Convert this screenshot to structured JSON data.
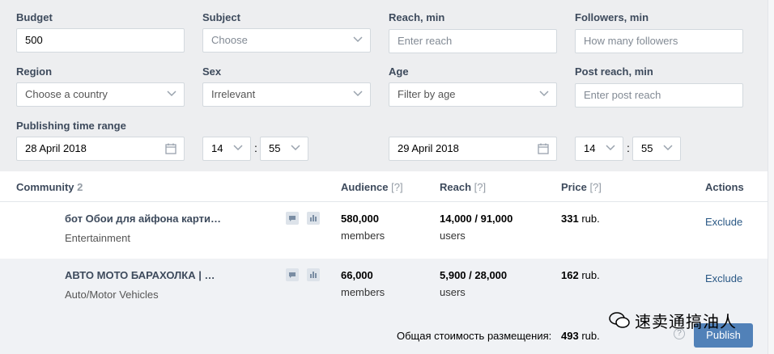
{
  "filters": {
    "budget": {
      "label": "Budget",
      "value": "500"
    },
    "subject": {
      "label": "Subject",
      "value": "Choose"
    },
    "reach_min": {
      "label": "Reach, min",
      "placeholder": "Enter reach"
    },
    "followers_min": {
      "label": "Followers, min",
      "placeholder": "How many followers"
    },
    "region": {
      "label": "Region",
      "value": "Choose a country"
    },
    "sex": {
      "label": "Sex",
      "value": "Irrelevant"
    },
    "age": {
      "label": "Age",
      "value": "Filter by age"
    },
    "post_reach_min": {
      "label": "Post reach, min",
      "placeholder": "Enter post reach"
    },
    "time_range": {
      "label": "Publishing time range",
      "start_date": "28 April 2018",
      "start_hour": "14",
      "start_minute": "55",
      "end_date": "29 April 2018",
      "end_hour": "14",
      "end_minute": "55",
      "separator": ":"
    }
  },
  "table": {
    "headers": {
      "community": "Community",
      "community_count": "2",
      "audience": "Audience",
      "reach": "Reach",
      "price": "Price",
      "actions": "Actions",
      "help": "[?]"
    },
    "rows": [
      {
        "name": "бот Обои для айфона карти…",
        "category": "Entertainment",
        "audience": "580,000",
        "audience_unit": "members",
        "reach": "14,000 / 91,000",
        "reach_unit": "users",
        "price": "331",
        "price_unit": "rub.",
        "action": "Exclude"
      },
      {
        "name": "АВТО МОТО БАРАХОЛКА | …",
        "category": "Auto/Motor Vehicles",
        "audience": "66,000",
        "audience_unit": "members",
        "reach": "5,900 / 28,000",
        "reach_unit": "users",
        "price": "162",
        "price_unit": "rub.",
        "action": "Exclude"
      }
    ]
  },
  "footer": {
    "total_label": "Общая стоимость размещения:",
    "total_value": "493",
    "total_unit": "rub.",
    "help": "?",
    "publish": "Publish"
  },
  "watermark": "速卖通搞油人",
  "icons": {
    "comment": "comment-icon",
    "stats": "bar-chart-icon",
    "calendar": "calendar-icon",
    "dropdown": "chevron-down-icon"
  },
  "colors": {
    "accent": "#5181b8",
    "link": "#2a5885",
    "label": "#3d4a5c",
    "panel_bg": "#edeef0"
  }
}
